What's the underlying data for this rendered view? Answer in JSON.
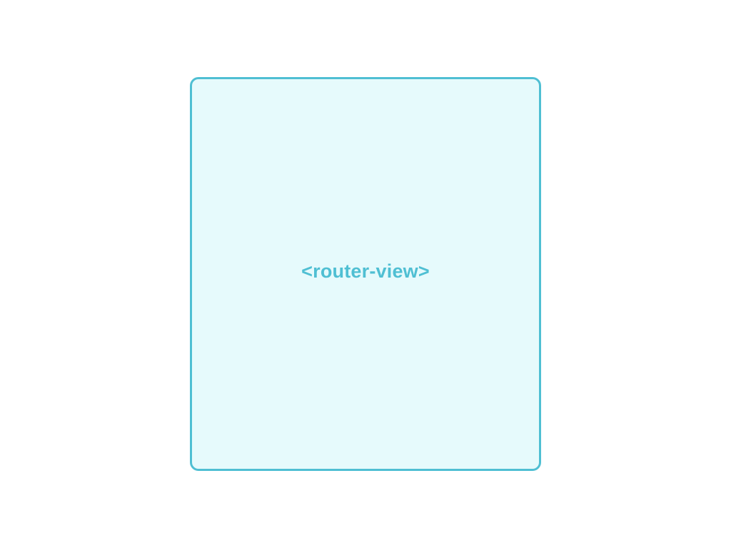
{
  "diagram": {
    "box": {
      "label": "<router-view>"
    }
  },
  "colors": {
    "border": "#4fbfd3",
    "fill": "#e6fafc",
    "label": "#4fbfd3",
    "background": "#ffffff"
  }
}
